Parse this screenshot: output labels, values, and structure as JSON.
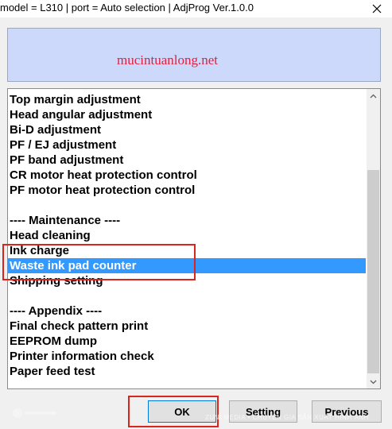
{
  "window": {
    "title": "model = L310 | port = Auto selection | AdjProg Ver.1.0.0"
  },
  "banner": {
    "watermark": "mucintuanlong.net"
  },
  "list": {
    "items": [
      {
        "label": "Top margin adjustment",
        "selected": false
      },
      {
        "label": "Head angular adjustment",
        "selected": false
      },
      {
        "label": "Bi-D adjustment",
        "selected": false
      },
      {
        "label": "PF / EJ adjustment",
        "selected": false
      },
      {
        "label": "PF band adjustment",
        "selected": false
      },
      {
        "label": "CR motor heat protection control",
        "selected": false
      },
      {
        "label": "PF motor heat protection control",
        "selected": false
      },
      {
        "label": "",
        "selected": false
      },
      {
        "label": "---- Maintenance ----",
        "selected": false
      },
      {
        "label": "Head cleaning",
        "selected": false
      },
      {
        "label": "Ink charge",
        "selected": false
      },
      {
        "label": "Waste ink pad counter",
        "selected": true
      },
      {
        "label": "Shipping setting",
        "selected": false
      },
      {
        "label": "",
        "selected": false
      },
      {
        "label": "---- Appendix ----",
        "selected": false
      },
      {
        "label": "Final check pattern print",
        "selected": false
      },
      {
        "label": "EEPROM dump",
        "selected": false
      },
      {
        "label": "Printer information check",
        "selected": false
      },
      {
        "label": "Paper feed test",
        "selected": false
      }
    ]
  },
  "buttons": {
    "ok": "OK",
    "setting": "Setting",
    "previous": "Previous"
  },
  "footer": {
    "watermark": "ZUNI.MEDIA • CHUYÊN GIA SẢN XUẤT HÌNH ẢNH"
  },
  "colors": {
    "banner_bg": "#cdd9fb",
    "selection": "#3399ff",
    "annotation_red": "#d9261c",
    "watermark_red": "#e0213f"
  }
}
